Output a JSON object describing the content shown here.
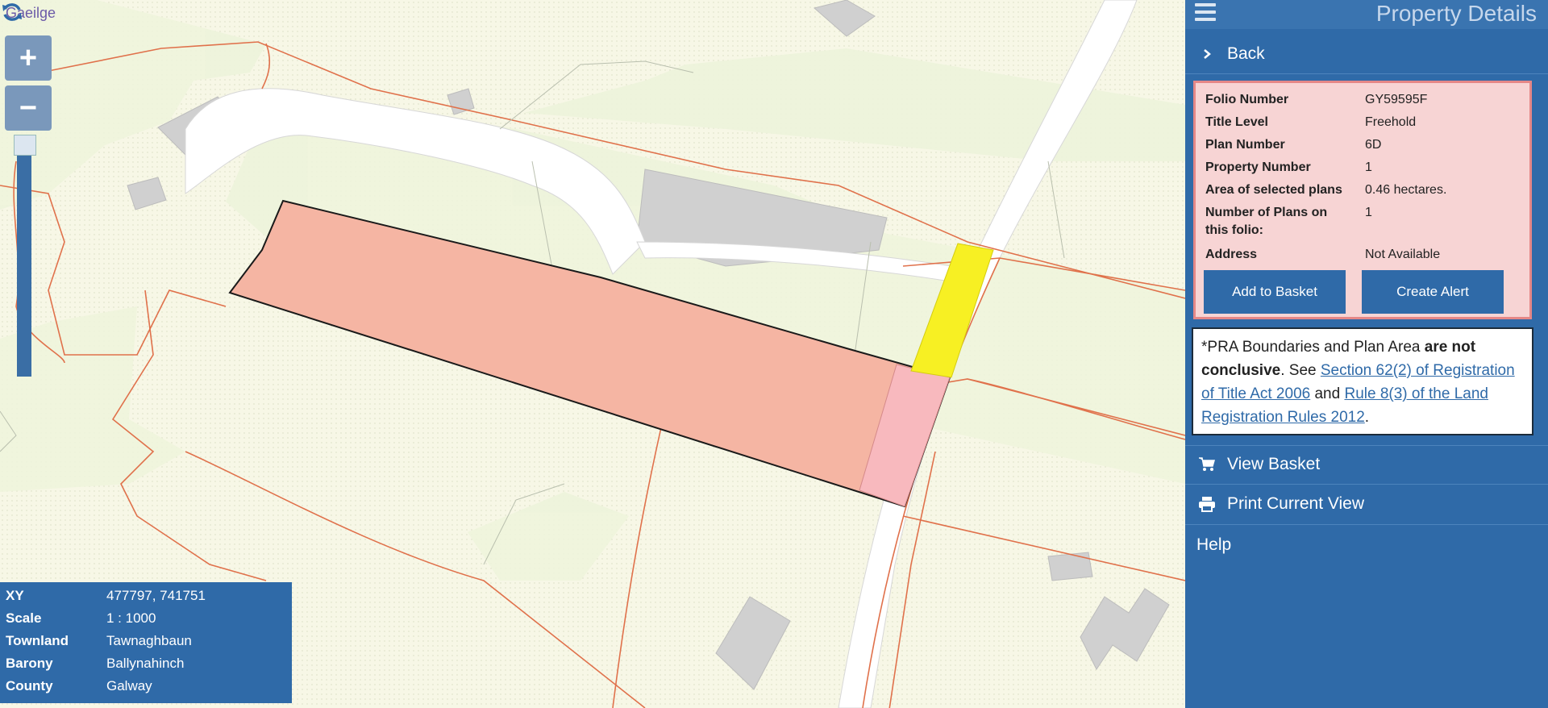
{
  "map": {
    "language_link": "Gaeilge",
    "zoom_in": "+",
    "zoom_out": "−",
    "info": {
      "rows": [
        {
          "label": "XY",
          "value": "477797, 741751"
        },
        {
          "label": "Scale",
          "value": "1 : 1000"
        },
        {
          "label": "Townland",
          "value": "Tawnaghbaun"
        },
        {
          "label": "Barony",
          "value": "Ballynahinch"
        },
        {
          "label": "County",
          "value": "Galway"
        }
      ]
    }
  },
  "panel": {
    "title": "Property Details",
    "back": "Back",
    "details": [
      {
        "label": "Folio Number",
        "value": "GY59595F"
      },
      {
        "label": "Title Level",
        "value": "Freehold"
      },
      {
        "label": "Plan Number",
        "value": "6D"
      },
      {
        "label": "Property Number",
        "value": "1"
      },
      {
        "label": "Area of selected plans",
        "value": "0.46 hectares."
      },
      {
        "label": "Number of Plans on",
        "value": "1"
      },
      {
        "label": "this folio:",
        "value": ""
      },
      {
        "label": "Address",
        "value": "Not Available"
      }
    ],
    "add_to_basket": "Add to Basket",
    "create_alert": "Create Alert",
    "disclaimer": {
      "prefix": "*PRA Boundaries and Plan Area ",
      "bold": "are not conclusive",
      "mid1": ". See ",
      "link1": "Section 62(2) of Registration of Title Act 2006",
      "mid2": " and ",
      "link2": "Rule 8(3) of the Land Registration Rules 2012",
      "suffix": "."
    },
    "view_basket": "View Basket",
    "print_view": "Print Current View",
    "help": "Help"
  },
  "colors": {
    "panel_bg": "#2f6aa8",
    "parcel_fill": "#f5b5a3",
    "parcel_pink": "#f8b9be",
    "highlight_yellow": "#f7f023",
    "boundary_red": "#e0714b"
  }
}
